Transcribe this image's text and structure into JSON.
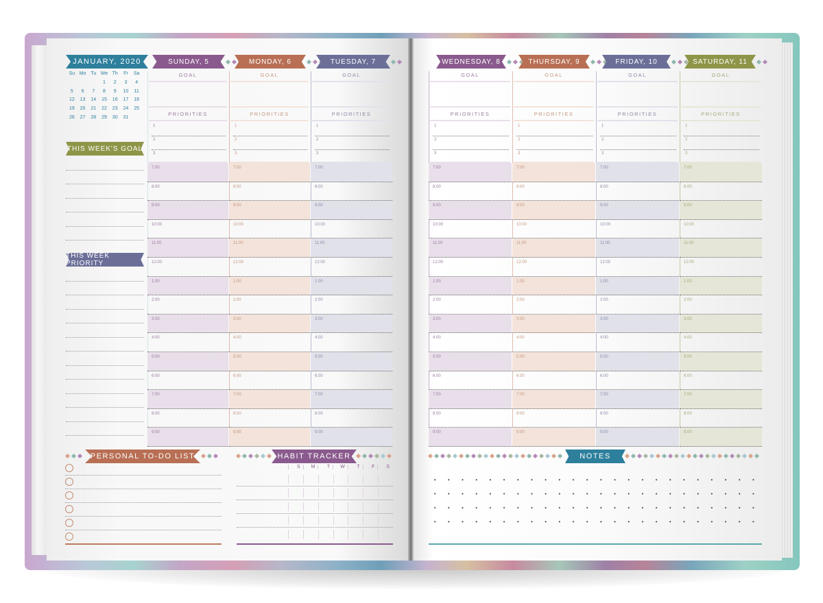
{
  "left_page": {
    "month_banner": "JANUARY, 2020",
    "mini_calendar": {
      "weekday_headers": [
        "Su",
        "Mo",
        "Tu",
        "We",
        "Th",
        "Fr",
        "Sa"
      ],
      "weeks": [
        [
          "",
          "",
          "",
          "1",
          "2",
          "3",
          "4"
        ],
        [
          "5",
          "6",
          "7",
          "8",
          "9",
          "10",
          "11"
        ],
        [
          "12",
          "13",
          "14",
          "15",
          "16",
          "17",
          "18"
        ],
        [
          "19",
          "20",
          "21",
          "22",
          "23",
          "24",
          "25"
        ],
        [
          "26",
          "27",
          "28",
          "29",
          "30",
          "31",
          ""
        ]
      ]
    },
    "this_weeks_goal_label": "THIS WEEK'S GOAL",
    "this_week_priority_label": "THIS WEEK PRIORITY",
    "todo_label": "PERSONAL TO-DO LIST",
    "habit_label": "HABIT TRACKER",
    "habit_days": [
      "S",
      "M",
      "T",
      "W",
      "T",
      "F",
      "S"
    ]
  },
  "right_page": {
    "notes_label": "NOTES"
  },
  "section_labels": {
    "goal": "GOAL",
    "priorities": "PRIORITIES"
  },
  "priority_numbers": [
    "1",
    "2",
    "3"
  ],
  "hours": [
    "7:00",
    "8:00",
    "9:00",
    "10:00",
    "11:00",
    "12:00",
    "1:00",
    "2:00",
    "3:00",
    "4:00",
    "5:00",
    "6:00",
    "7:00",
    "8:00",
    "9:00"
  ],
  "days": [
    {
      "label": "SUNDAY, 5",
      "color": "#8a5a8e",
      "tint": "#e9dfea",
      "text": "#9a7aa0",
      "page": "left"
    },
    {
      "label": "MONDAY, 6",
      "color": "#b86f54",
      "tint": "#f3e3da",
      "text": "#c49680",
      "page": "left"
    },
    {
      "label": "TUESDAY, 7",
      "color": "#6b6f98",
      "tint": "#e1e1ea",
      "text": "#8a8ca8",
      "page": "left"
    },
    {
      "label": "WEDNESDAY, 8",
      "color": "#8a5a8e",
      "tint": "#e9dfea",
      "text": "#9a7aa0",
      "page": "right"
    },
    {
      "label": "THURSDAY, 9",
      "color": "#b86f54",
      "tint": "#f3e3da",
      "text": "#c49680",
      "page": "right"
    },
    {
      "label": "FRIDAY, 10",
      "color": "#6b6f98",
      "tint": "#e1e1ea",
      "text": "#8a8ca8",
      "page": "right"
    },
    {
      "label": "SATURDAY, 11",
      "color": "#8f9548",
      "tint": "#e6e6d8",
      "text": "#a6a87a",
      "page": "right"
    }
  ],
  "colors": {
    "teal": "#2d7f9c",
    "olive": "#8f9548",
    "slate": "#6b6f98",
    "rust": "#b86f54",
    "plum": "#8a5a8e"
  }
}
